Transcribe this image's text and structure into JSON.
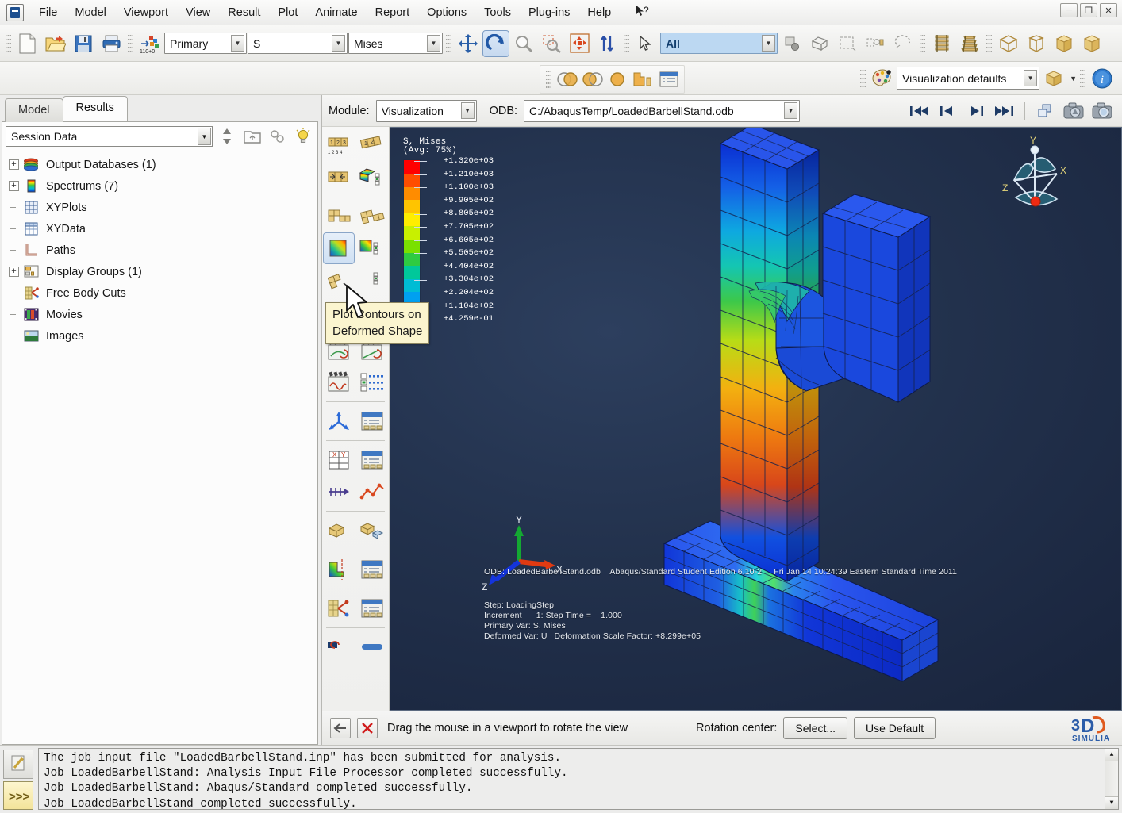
{
  "menu": {
    "items": [
      "File",
      "Model",
      "Viewport",
      "View",
      "Result",
      "Plot",
      "Animate",
      "Report",
      "Options",
      "Tools",
      "Plug-ins",
      "Help"
    ],
    "help_cursor_icon": "arrow-question-icon",
    "window_buttons": [
      "minimize",
      "restore",
      "close"
    ]
  },
  "toolbar": {
    "file_icons": [
      "new-file-icon",
      "open-file-icon",
      "save-icon",
      "print-icon"
    ],
    "field_output_icon": "field-output-icon",
    "primary_select": "Primary",
    "variable_select": "S",
    "component_select": "Mises",
    "view_icons": [
      "pan-icon",
      "rotate-icon",
      "magnify-icon",
      "box-zoom-icon",
      "fit-all-icon",
      "auto-fit-icon"
    ],
    "select_arrow_icon": "select-arrow-icon",
    "selection_filter": "All",
    "render_icons": [
      "wireframe-icon",
      "hidden-line-icon",
      "shaded-icon",
      "render-beam-icon"
    ],
    "view_cube_icons": [
      "iso-view-icon",
      "front-view-icon",
      "shaded-cube-icon",
      "solid-cube-icon"
    ]
  },
  "toolbar2": {
    "color_palette_icon": "color-palette-icon",
    "defaults_select": "Visualization defaults",
    "view_cut_icon": "view-cut-icon",
    "info_icon": "info-icon",
    "viewport_icons": [
      "overlay-plot-icon",
      "link-viewports-icon",
      "single-viewport-icon",
      "viewport-layout-icon",
      "viewport-annotation-icon"
    ]
  },
  "left_panel": {
    "tabs": [
      {
        "label": "Model",
        "active": false
      },
      {
        "label": "Results",
        "active": true
      }
    ],
    "session_select": "Session Data",
    "tool_icons": [
      "up-down-spinner-icon",
      "open-container-icon",
      "link-icon",
      "lightbulb-icon"
    ],
    "tree": [
      {
        "label": "Output Databases (1)",
        "icon": "output-database-icon",
        "expandable": true
      },
      {
        "label": "Spectrums (7)",
        "icon": "spectrum-icon",
        "expandable": true
      },
      {
        "label": "XYPlots",
        "icon": "xyplot-icon",
        "expandable": false
      },
      {
        "label": "XYData",
        "icon": "xydata-icon",
        "expandable": false
      },
      {
        "label": "Paths",
        "icon": "path-icon",
        "expandable": false
      },
      {
        "label": "Display Groups (1)",
        "icon": "display-group-icon",
        "expandable": true
      },
      {
        "label": "Free Body Cuts",
        "icon": "free-body-cut-icon",
        "expandable": false
      },
      {
        "label": "Movies",
        "icon": "movie-icon",
        "expandable": false
      },
      {
        "label": "Images",
        "icon": "image-icon",
        "expandable": false
      }
    ]
  },
  "module_bar": {
    "module_label": "Module:",
    "module_value": "Visualization",
    "odb_label": "ODB:",
    "odb_value": "C:/AbaqusTemp/LoadedBarbellStand.odb",
    "vcr_icons": [
      "first-frame-icon",
      "previous-frame-icon",
      "next-frame-icon",
      "last-frame-icon"
    ],
    "extra_icons": [
      "overlay-icon",
      "print-viewport-icon",
      "snapshot-icon"
    ]
  },
  "tooltip": {
    "line1": "Plot Contours on",
    "line2": "Deformed Shape"
  },
  "viewport": {
    "legend": {
      "title": "S, Mises",
      "subtitle": "(Avg: 75%)",
      "values": [
        "+1.320e+03",
        "+1.210e+03",
        "+1.100e+03",
        "+9.905e+02",
        "+8.805e+02",
        "+7.705e+02",
        "+6.605e+02",
        "+5.505e+02",
        "+4.404e+02",
        "+3.304e+02",
        "+2.204e+02",
        "+1.104e+02",
        "+4.259e-01"
      ],
      "colors": [
        "#ff0000",
        "#ff4d00",
        "#ff8c00",
        "#ffc400",
        "#ffee00",
        "#c8f000",
        "#7ae000",
        "#2ecb42",
        "#00c89a",
        "#00bcd4",
        "#00a0f0",
        "#1569e6",
        "#0a2ed2"
      ]
    },
    "header_line": "ODB: LoadedBarbellStand.odb    Abaqus/Standard Student Edition 6.10-2     Fri Jan 14 10:24:39 Eastern Standard Time 2011",
    "info_lines": [
      "Step: LoadingStep",
      "Increment      1: Step Time =    1.000",
      "Primary Var: S, Mises",
      "Deformed Var: U   Deformation Scale Factor: +8.299e+05"
    ],
    "triad_corner_labels": {
      "x": "X",
      "y": "Y",
      "z": "Z"
    },
    "triad_model_labels": {
      "x": "X",
      "y": "Y",
      "z": "Z"
    }
  },
  "prompt_bar": {
    "back_icon": "back-arrow-icon",
    "cancel_icon": "cancel-x-icon",
    "message": "Drag the mouse in a viewport to rotate the view",
    "rotation_center_label": "Rotation center:",
    "select_button": "Select...",
    "use_default_button": "Use Default",
    "brand_top": "3DS",
    "brand_bottom": "SIMULIA"
  },
  "message_area": {
    "tabs": [
      "message-area-icon",
      "command-line-icon"
    ],
    "lines": [
      "The job input file \"LoadedBarbellStand.inp\" has been submitted for analysis.",
      "Job LoadedBarbellStand: Analysis Input File Processor completed successfully.",
      "Job LoadedBarbellStand: Abaqus/Standard completed successfully.",
      "Job LoadedBarbellStand completed successfully."
    ],
    "prompt_glyph": ">>>"
  },
  "colors": {
    "viewport_bg_top": "#2d3f5e",
    "viewport_bg_bottom": "#172236",
    "accent_blue": "#1569e6",
    "tooltip_bg": "#fbf5cf"
  }
}
